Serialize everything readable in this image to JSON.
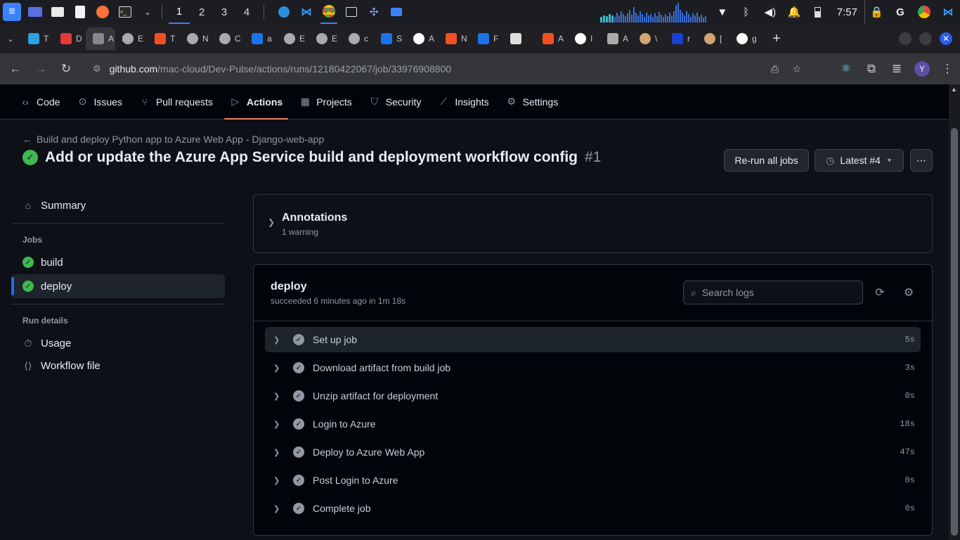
{
  "os_taskbar": {
    "workspaces": [
      "1",
      "2",
      "3",
      "4"
    ],
    "active_workspace": "1",
    "clock": "7:57"
  },
  "browser": {
    "tabs": [
      {
        "icon": "telegram-icon",
        "color": "#2aa3e0",
        "text": "T"
      },
      {
        "icon": "youtube-icon",
        "color": "#e53935",
        "text": "D"
      },
      {
        "icon": "generic-icon",
        "color": "#888888",
        "text": "A",
        "active": true
      },
      {
        "icon": "globe-icon",
        "color": "#aaaaaa",
        "text": "E"
      },
      {
        "icon": "microsoft-icon",
        "color": "#f25022",
        "text": "T"
      },
      {
        "icon": "globe-icon",
        "color": "#aaaaaa",
        "text": "N"
      },
      {
        "icon": "globe-icon",
        "color": "#aaaaaa",
        "text": "C"
      },
      {
        "icon": "azure-icon",
        "color": "#1a73e8",
        "text": "a"
      },
      {
        "icon": "globe-icon",
        "color": "#aaaaaa",
        "text": "E"
      },
      {
        "icon": "globe-icon",
        "color": "#aaaaaa",
        "text": "E"
      },
      {
        "icon": "globe-icon",
        "color": "#aaaaaa",
        "text": "c"
      },
      {
        "icon": "azure-icon",
        "color": "#1a73e8",
        "text": "S"
      },
      {
        "icon": "github-icon",
        "color": "#ffffff",
        "text": "A"
      },
      {
        "icon": "microsoft-icon",
        "color": "#f25022",
        "text": "N"
      },
      {
        "icon": "azure-icon",
        "color": "#1a73e8",
        "text": "F"
      },
      {
        "icon": "openai-icon",
        "color": "#dddddd",
        "text": ""
      },
      {
        "icon": "microsoft-icon",
        "color": "#f25022",
        "text": "A"
      },
      {
        "icon": "github-icon",
        "color": "#ffffff",
        "text": "I"
      },
      {
        "icon": "audio-icon",
        "color": "#aaaaaa",
        "text": "A"
      },
      {
        "icon": "avatar-icon",
        "color": "#d4a373",
        "text": "\\"
      },
      {
        "icon": "n-icon",
        "color": "#1a3fd1",
        "text": "r"
      },
      {
        "icon": "avatar-icon",
        "color": "#d4a373",
        "text": "["
      },
      {
        "icon": "google-icon",
        "color": "#ffffff",
        "text": "g"
      }
    ],
    "url": {
      "host": "github.com",
      "path": "/mac-cloud/Dev-Pulse/actions/runs/12180422067/job/33976908800"
    },
    "profile_initial": "Y"
  },
  "repo_nav": {
    "items": [
      {
        "label": "Code",
        "icon": "code-icon"
      },
      {
        "label": "Issues",
        "icon": "issue-icon"
      },
      {
        "label": "Pull requests",
        "icon": "pull-request-icon"
      },
      {
        "label": "Actions",
        "icon": "play-icon",
        "active": true
      },
      {
        "label": "Projects",
        "icon": "table-icon"
      },
      {
        "label": "Security",
        "icon": "shield-icon"
      },
      {
        "label": "Insights",
        "icon": "graph-icon"
      },
      {
        "label": "Settings",
        "icon": "gear-icon"
      }
    ]
  },
  "header": {
    "back_link": "Build and deploy Python app to Azure Web App - Django-web-app",
    "title": "Add or update the Azure App Service build and deployment workflow config",
    "run_number": "#1",
    "rerun_label": "Re-run all jobs",
    "latest_label": "Latest #4"
  },
  "sidebar": {
    "summary": "Summary",
    "jobs_heading": "Jobs",
    "jobs": [
      {
        "label": "build",
        "status": "success"
      },
      {
        "label": "deploy",
        "status": "success",
        "active": true
      }
    ],
    "run_details_heading": "Run details",
    "run_details": [
      {
        "label": "Usage",
        "icon": "stopwatch-icon"
      },
      {
        "label": "Workflow file",
        "icon": "file-code-icon"
      }
    ]
  },
  "annotations": {
    "title": "Annotations",
    "subtitle": "1 warning"
  },
  "job": {
    "name": "deploy",
    "meta": "succeeded 6 minutes ago in 1m 18s",
    "search_placeholder": "Search logs",
    "steps": [
      {
        "name": "Set up job",
        "duration": "5s"
      },
      {
        "name": "Download artifact from build job",
        "duration": "3s"
      },
      {
        "name": "Unzip artifact for deployment",
        "duration": "0s"
      },
      {
        "name": "Login to Azure",
        "duration": "18s"
      },
      {
        "name": "Deploy to Azure Web App",
        "duration": "47s"
      },
      {
        "name": "Post Login to Azure",
        "duration": "0s"
      },
      {
        "name": "Complete job",
        "duration": "0s"
      }
    ]
  },
  "colors": {
    "success": "#3fb950",
    "accent_underline": "#f78166",
    "active_bar": "#1f6feb",
    "background": "#0d1117"
  }
}
